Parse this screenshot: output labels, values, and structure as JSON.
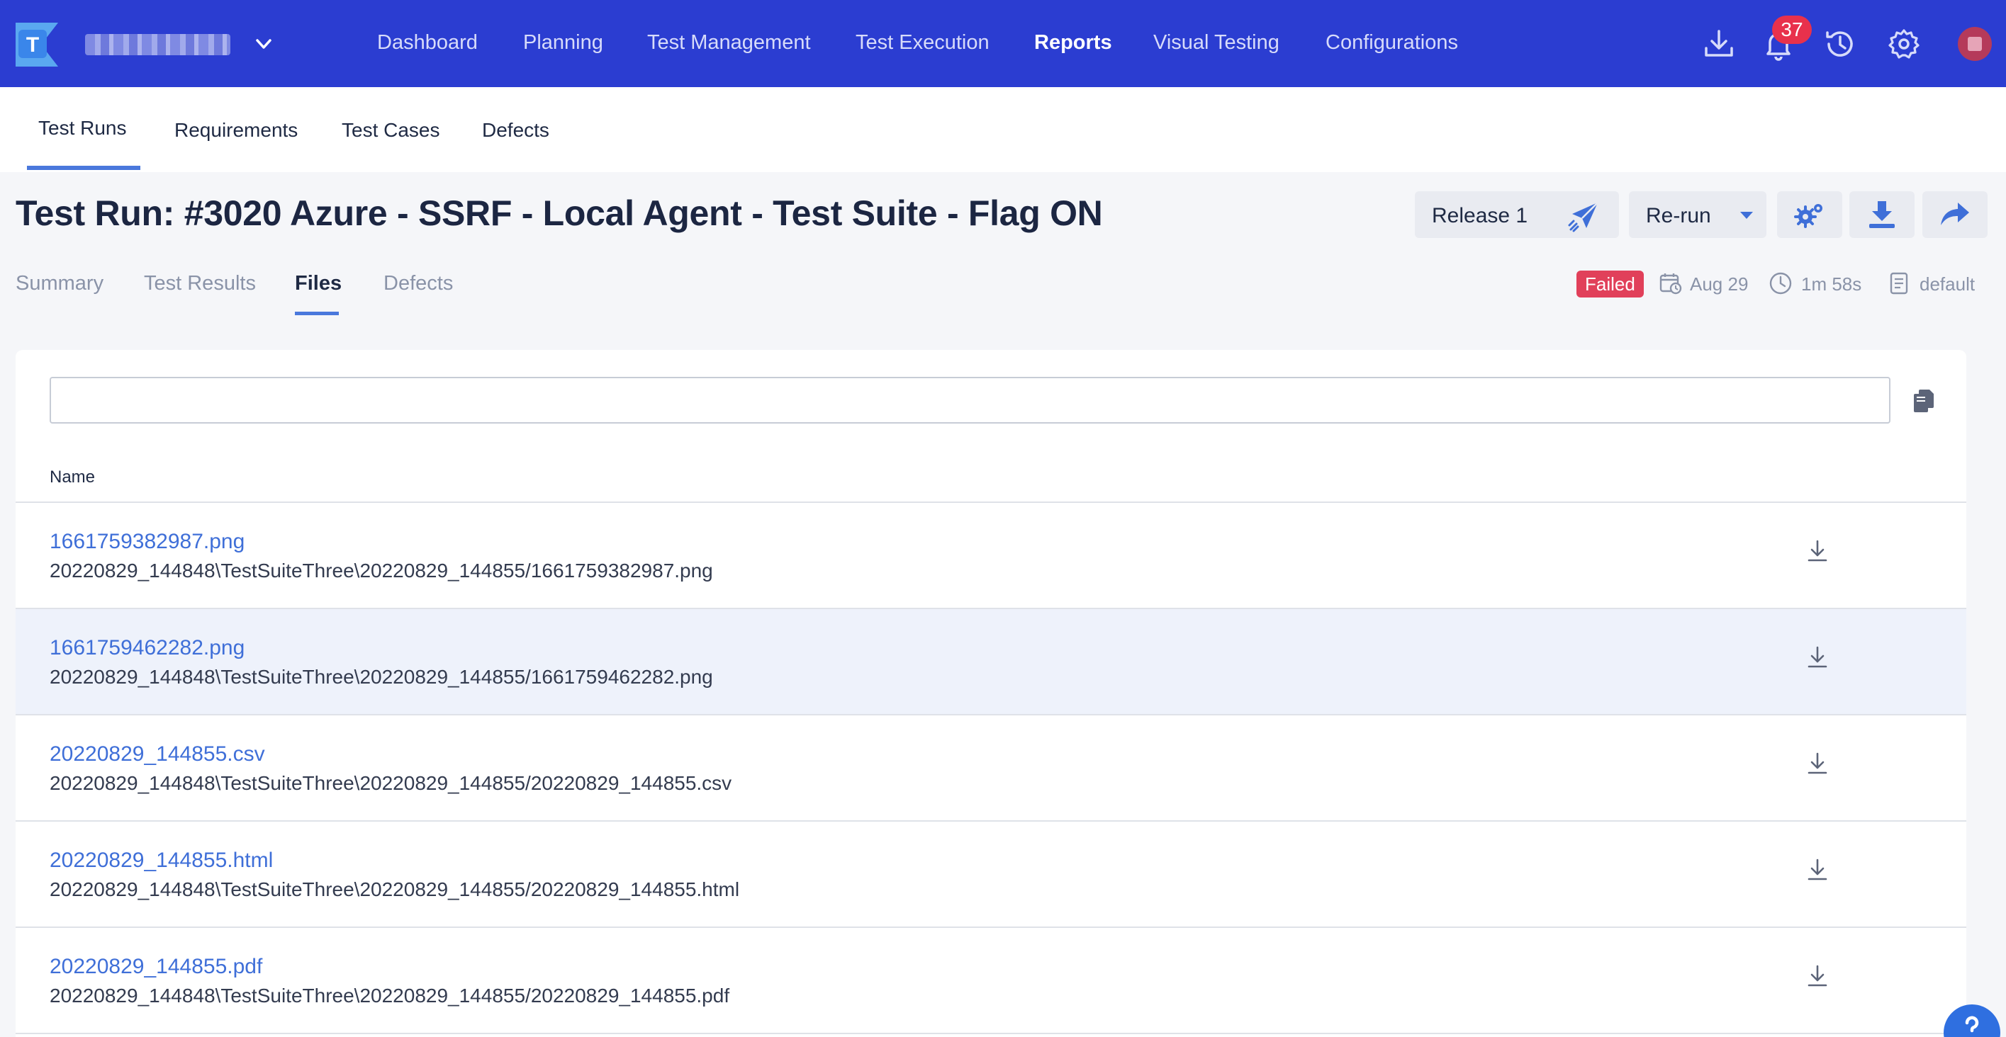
{
  "app": {
    "accent_color": "#2b3dd1",
    "link_color": "#3f6fd8"
  },
  "topnav": {
    "items": [
      "Dashboard",
      "Planning",
      "Test Management",
      "Test Execution",
      "Reports",
      "Visual Testing",
      "Configurations"
    ],
    "active": "Reports",
    "notification_count": "37",
    "icons": [
      "download-icon",
      "bell-icon",
      "history-icon",
      "gear-icon",
      "avatar"
    ]
  },
  "subnav": {
    "tabs": [
      "Test Runs",
      "Requirements",
      "Test Cases",
      "Defects"
    ],
    "active": "Test Runs"
  },
  "page": {
    "title": "Test Run: #3020 Azure - SSRF - Local Agent - Test Suite - Flag ON",
    "release_label": "Release 1",
    "rerun_label": "Re-run"
  },
  "run_tabs": {
    "tabs": [
      "Summary",
      "Test Results",
      "Files",
      "Defects"
    ],
    "active": "Files"
  },
  "run_meta": {
    "status": "Failed",
    "status_color": "#e1405a",
    "date": "Aug 29",
    "duration": "1m 58s",
    "profile": "default"
  },
  "files": {
    "search_value": "",
    "column_name": "Name",
    "rows": [
      {
        "name": "1661759382987.png",
        "path": "20220829_144848\\TestSuiteThree\\20220829_144855/1661759382987.png"
      },
      {
        "name": "1661759462282.png",
        "path": "20220829_144848\\TestSuiteThree\\20220829_144855/1661759462282.png"
      },
      {
        "name": "20220829_144855.csv",
        "path": "20220829_144848\\TestSuiteThree\\20220829_144855/20220829_144855.csv"
      },
      {
        "name": "20220829_144855.html",
        "path": "20220829_144848\\TestSuiteThree\\20220829_144855/20220829_144855.html"
      },
      {
        "name": "20220829_144855.pdf",
        "path": "20220829_144848\\TestSuiteThree\\20220829_144855/20220829_144855.pdf"
      }
    ]
  }
}
